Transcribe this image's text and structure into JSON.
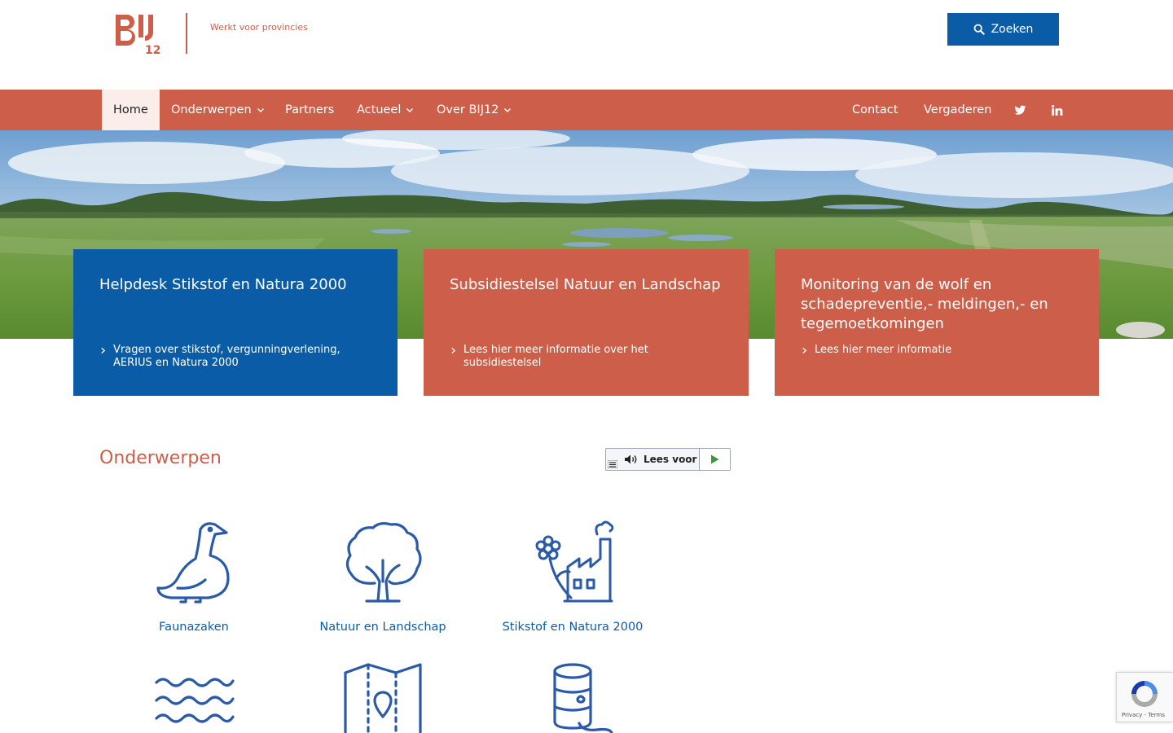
{
  "header": {
    "logo_text_main": "BIJ",
    "logo_text_num": "12",
    "tagline": "Werkt voor provincies",
    "search_label": "Zoeken"
  },
  "nav": {
    "items": [
      {
        "label": "Home",
        "has_dropdown": false,
        "active": true
      },
      {
        "label": "Onderwerpen",
        "has_dropdown": true
      },
      {
        "label": "Partners",
        "has_dropdown": false
      },
      {
        "label": "Actueel",
        "has_dropdown": true
      },
      {
        "label": "Over BIJ12",
        "has_dropdown": true
      }
    ],
    "right_items": [
      {
        "label": "Contact"
      },
      {
        "label": "Vergaderen"
      }
    ],
    "social": [
      "twitter-icon",
      "linkedin-icon"
    ]
  },
  "cards": [
    {
      "title": "Helpdesk Stikstof en Natura 2000",
      "link": "Vragen over stikstof, vergunningverlening, AERIUS en Natura 2000",
      "color": "#0a5ca6"
    },
    {
      "title": "Subsidiestelsel Natuur en Landschap",
      "link": "Lees hier meer informatie over het subsidiestelsel",
      "color": "#cd5f4a"
    },
    {
      "title": "Monitoring van de wolf en schadepreventie,- meldingen,- en tegemoetkomingen",
      "link": "Lees hier meer informatie",
      "color": "#cd5f4a"
    }
  ],
  "section": {
    "title": "Onderwerpen"
  },
  "readspeaker": {
    "label": "Lees voor"
  },
  "topics": [
    {
      "label": "Faunazaken",
      "icon": "goose-icon"
    },
    {
      "label": "Natuur en Landschap",
      "icon": "tree-icon"
    },
    {
      "label": "Stikstof en Natura 2000",
      "icon": "flower-factory-icon"
    },
    {
      "label": "",
      "icon": "water-waves-icon"
    },
    {
      "label": "",
      "icon": "map-pin-icon"
    },
    {
      "label": "",
      "icon": "barrel-spill-icon"
    }
  ],
  "recaptcha": {
    "links": "Privacy - Terms"
  },
  "colors": {
    "brand_red": "#cd5f4a",
    "brand_blue": "#0a5ca6"
  }
}
